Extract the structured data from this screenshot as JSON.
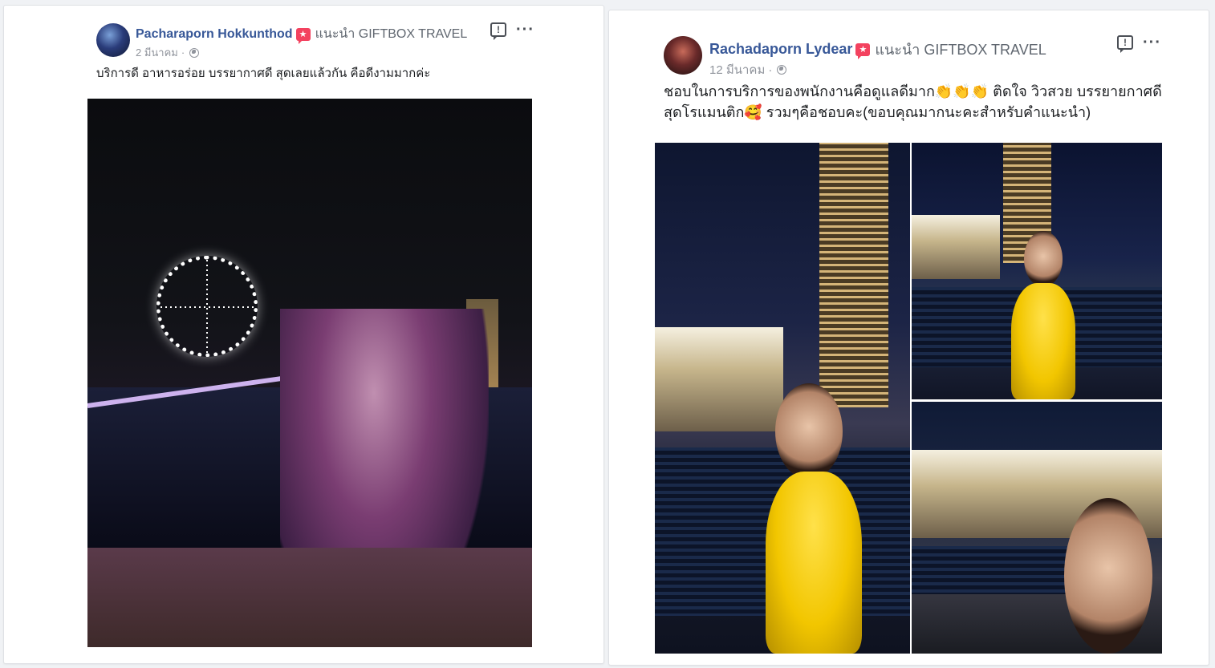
{
  "posts": [
    {
      "author": "Pacharaporn Hokkunthod",
      "recommends_text": "แนะนำ GIFTBOX TRAVEL",
      "date": "2 มีนาคม",
      "meta_sep": "·",
      "text": "บริการดี อาหารอร่อย บรรยากาศดี สุดเลยแล้วกัน คือดีงามมากค่ะ",
      "report_label": "!",
      "more_label": "···"
    },
    {
      "author": "Rachadaporn Lydear",
      "recommends_text": "แนะนำ GIFTBOX TRAVEL",
      "date": "12 มีนาคม",
      "meta_sep": "·",
      "text": "ชอบในการบริการของพนักงานคือดูแลดีมาก👏👏👏 ติดใจ วิวสวย บรรยายกาศดี\nสุดโรแมนติก🥰 รวมๆคือชอบคะ(ขอบคุณมากนะคะสำหรับคำแนะนำ)",
      "report_label": "!",
      "more_label": "···"
    }
  ],
  "icons": {
    "recommend_badge": "recommend-badge-icon",
    "privacy": "globe-icon",
    "report": "report-icon",
    "more": "more-icon"
  },
  "colors": {
    "author_link": "#385898",
    "recommend_badge": "#f3425f",
    "meta_gray": "#90949c"
  }
}
